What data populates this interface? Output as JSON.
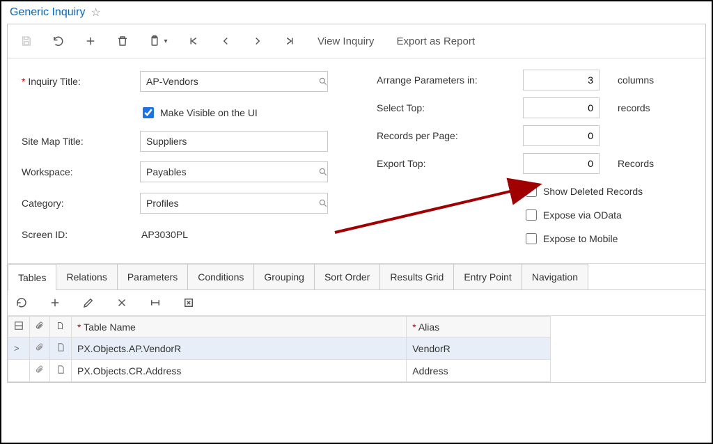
{
  "header": {
    "title": "Generic Inquiry"
  },
  "toolbar": {
    "view_inquiry_label": "View Inquiry",
    "export_report_label": "Export as Report"
  },
  "form": {
    "inquiry_title_label": "Inquiry Title:",
    "inquiry_title_value": "AP-Vendors",
    "make_visible_label": "Make Visible on the UI",
    "make_visible_checked": true,
    "site_map_title_label": "Site Map Title:",
    "site_map_title_value": "Suppliers",
    "workspace_label": "Workspace:",
    "workspace_value": "Payables",
    "category_label": "Category:",
    "category_value": "Profiles",
    "screen_id_label": "Screen ID:",
    "screen_id_value": "AP3030PL",
    "arrange_label": "Arrange Parameters in:",
    "arrange_value": "3",
    "arrange_unit": "columns",
    "select_top_label": "Select Top:",
    "select_top_value": "0",
    "select_top_unit": "records",
    "rpp_label": "Records per Page:",
    "rpp_value": "0",
    "export_top_label": "Export Top:",
    "export_top_value": "0",
    "export_top_unit": "Records",
    "show_deleted_label": "Show Deleted Records",
    "expose_odata_label": "Expose via OData",
    "expose_mobile_label": "Expose to Mobile"
  },
  "tabs": {
    "items": [
      "Tables",
      "Relations",
      "Parameters",
      "Conditions",
      "Grouping",
      "Sort Order",
      "Results Grid",
      "Entry Point",
      "Navigation"
    ],
    "active": 0
  },
  "grid": {
    "headers": {
      "table_name": "Table Name",
      "alias": "Alias"
    },
    "rows": [
      {
        "table_name": "PX.Objects.AP.VendorR",
        "alias": "VendorR"
      },
      {
        "table_name": "PX.Objects.CR.Address",
        "alias": "Address"
      }
    ]
  }
}
